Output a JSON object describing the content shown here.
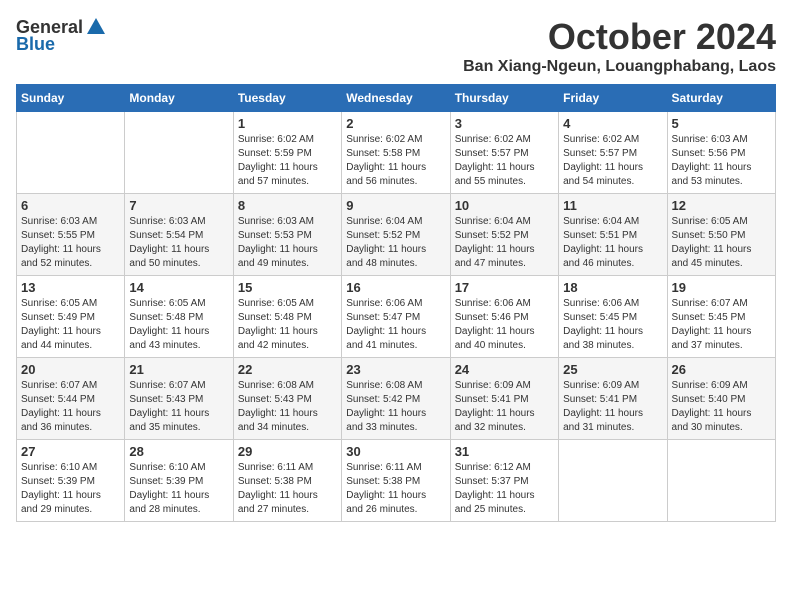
{
  "header": {
    "logo_general": "General",
    "logo_blue": "Blue",
    "month_title": "October 2024",
    "subtitle": "Ban Xiang-Ngeun, Louangphabang, Laos"
  },
  "days_of_week": [
    "Sunday",
    "Monday",
    "Tuesday",
    "Wednesday",
    "Thursday",
    "Friday",
    "Saturday"
  ],
  "weeks": [
    [
      {
        "day": "",
        "info": ""
      },
      {
        "day": "",
        "info": ""
      },
      {
        "day": "1",
        "info": "Sunrise: 6:02 AM\nSunset: 5:59 PM\nDaylight: 11 hours\nand 57 minutes."
      },
      {
        "day": "2",
        "info": "Sunrise: 6:02 AM\nSunset: 5:58 PM\nDaylight: 11 hours\nand 56 minutes."
      },
      {
        "day": "3",
        "info": "Sunrise: 6:02 AM\nSunset: 5:57 PM\nDaylight: 11 hours\nand 55 minutes."
      },
      {
        "day": "4",
        "info": "Sunrise: 6:02 AM\nSunset: 5:57 PM\nDaylight: 11 hours\nand 54 minutes."
      },
      {
        "day": "5",
        "info": "Sunrise: 6:03 AM\nSunset: 5:56 PM\nDaylight: 11 hours\nand 53 minutes."
      }
    ],
    [
      {
        "day": "6",
        "info": "Sunrise: 6:03 AM\nSunset: 5:55 PM\nDaylight: 11 hours\nand 52 minutes."
      },
      {
        "day": "7",
        "info": "Sunrise: 6:03 AM\nSunset: 5:54 PM\nDaylight: 11 hours\nand 50 minutes."
      },
      {
        "day": "8",
        "info": "Sunrise: 6:03 AM\nSunset: 5:53 PM\nDaylight: 11 hours\nand 49 minutes."
      },
      {
        "day": "9",
        "info": "Sunrise: 6:04 AM\nSunset: 5:52 PM\nDaylight: 11 hours\nand 48 minutes."
      },
      {
        "day": "10",
        "info": "Sunrise: 6:04 AM\nSunset: 5:52 PM\nDaylight: 11 hours\nand 47 minutes."
      },
      {
        "day": "11",
        "info": "Sunrise: 6:04 AM\nSunset: 5:51 PM\nDaylight: 11 hours\nand 46 minutes."
      },
      {
        "day": "12",
        "info": "Sunrise: 6:05 AM\nSunset: 5:50 PM\nDaylight: 11 hours\nand 45 minutes."
      }
    ],
    [
      {
        "day": "13",
        "info": "Sunrise: 6:05 AM\nSunset: 5:49 PM\nDaylight: 11 hours\nand 44 minutes."
      },
      {
        "day": "14",
        "info": "Sunrise: 6:05 AM\nSunset: 5:48 PM\nDaylight: 11 hours\nand 43 minutes."
      },
      {
        "day": "15",
        "info": "Sunrise: 6:05 AM\nSunset: 5:48 PM\nDaylight: 11 hours\nand 42 minutes."
      },
      {
        "day": "16",
        "info": "Sunrise: 6:06 AM\nSunset: 5:47 PM\nDaylight: 11 hours\nand 41 minutes."
      },
      {
        "day": "17",
        "info": "Sunrise: 6:06 AM\nSunset: 5:46 PM\nDaylight: 11 hours\nand 40 minutes."
      },
      {
        "day": "18",
        "info": "Sunrise: 6:06 AM\nSunset: 5:45 PM\nDaylight: 11 hours\nand 38 minutes."
      },
      {
        "day": "19",
        "info": "Sunrise: 6:07 AM\nSunset: 5:45 PM\nDaylight: 11 hours\nand 37 minutes."
      }
    ],
    [
      {
        "day": "20",
        "info": "Sunrise: 6:07 AM\nSunset: 5:44 PM\nDaylight: 11 hours\nand 36 minutes."
      },
      {
        "day": "21",
        "info": "Sunrise: 6:07 AM\nSunset: 5:43 PM\nDaylight: 11 hours\nand 35 minutes."
      },
      {
        "day": "22",
        "info": "Sunrise: 6:08 AM\nSunset: 5:43 PM\nDaylight: 11 hours\nand 34 minutes."
      },
      {
        "day": "23",
        "info": "Sunrise: 6:08 AM\nSunset: 5:42 PM\nDaylight: 11 hours\nand 33 minutes."
      },
      {
        "day": "24",
        "info": "Sunrise: 6:09 AM\nSunset: 5:41 PM\nDaylight: 11 hours\nand 32 minutes."
      },
      {
        "day": "25",
        "info": "Sunrise: 6:09 AM\nSunset: 5:41 PM\nDaylight: 11 hours\nand 31 minutes."
      },
      {
        "day": "26",
        "info": "Sunrise: 6:09 AM\nSunset: 5:40 PM\nDaylight: 11 hours\nand 30 minutes."
      }
    ],
    [
      {
        "day": "27",
        "info": "Sunrise: 6:10 AM\nSunset: 5:39 PM\nDaylight: 11 hours\nand 29 minutes."
      },
      {
        "day": "28",
        "info": "Sunrise: 6:10 AM\nSunset: 5:39 PM\nDaylight: 11 hours\nand 28 minutes."
      },
      {
        "day": "29",
        "info": "Sunrise: 6:11 AM\nSunset: 5:38 PM\nDaylight: 11 hours\nand 27 minutes."
      },
      {
        "day": "30",
        "info": "Sunrise: 6:11 AM\nSunset: 5:38 PM\nDaylight: 11 hours\nand 26 minutes."
      },
      {
        "day": "31",
        "info": "Sunrise: 6:12 AM\nSunset: 5:37 PM\nDaylight: 11 hours\nand 25 minutes."
      },
      {
        "day": "",
        "info": ""
      },
      {
        "day": "",
        "info": ""
      }
    ]
  ]
}
